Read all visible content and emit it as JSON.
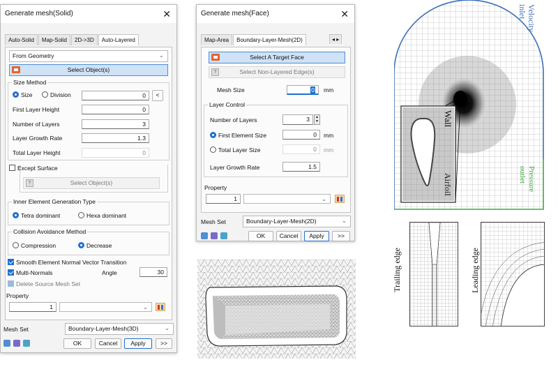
{
  "solid": {
    "title": "Generate mesh(Solid)",
    "tabs": [
      "Auto-Solid",
      "Map-Solid",
      "2D->3D",
      "Auto-Layered"
    ],
    "source": "From Geometry",
    "select_btn": "Select Object(s)",
    "size_method": {
      "label": "Size Method",
      "opt_size": "Size",
      "opt_div": "Division",
      "value": "0",
      "btn": "<"
    },
    "first_layer": {
      "label": "First Layer Height",
      "value": "0"
    },
    "num_layers": {
      "label": "Number of Layers",
      "value": "3"
    },
    "growth": {
      "label": "Layer Growth Rate",
      "value": "1.3"
    },
    "total": {
      "label": "Total Layer Height",
      "value": "0"
    },
    "except": {
      "label": "Except Surface",
      "btn": "Select Object(s)"
    },
    "inner": {
      "label": "Inner Element Generation Type",
      "opt1": "Tetra dominant",
      "opt2": "Hexa dominant"
    },
    "collision": {
      "label": "Collision Avoidance Method",
      "opt1": "Compression",
      "opt2": "Decrease"
    },
    "smooth": "Smooth Element Normal Vector Transition",
    "multi": "Multi-Normals",
    "angle_label": "Angle",
    "angle": "30",
    "delete_src": "Delete Source Mesh Set",
    "property": {
      "label": "Property",
      "id": "1"
    },
    "meshset": {
      "label": "Mesh Set",
      "value": "Boundary-Layer-Mesh(3D)"
    },
    "ok": "OK",
    "cancel": "Cancel",
    "apply": "Apply",
    "more": ">>"
  },
  "face": {
    "title": "Generate mesh(Face)",
    "tabs": [
      "Map-Area",
      "Boundary-Layer-Mesh(2D)"
    ],
    "select_face": "Select A Target Face",
    "select_edge": "Select Non-Layered Edge(s)",
    "mesh_size": {
      "label": "Mesh Size",
      "value": "0",
      "unit": "mm"
    },
    "layer_control": "Layer Control",
    "num_layers": {
      "label": "Number of Layers",
      "value": "3"
    },
    "first_elem": {
      "label": "First Element Size",
      "value": "0",
      "unit": "mm"
    },
    "total_size": {
      "label": "Total Layer Size",
      "value": "0",
      "unit": "mm"
    },
    "growth": {
      "label": "Layer Growth Rate",
      "value": "1.5"
    },
    "property": {
      "label": "Property",
      "id": "1"
    },
    "meshset": {
      "label": "Mesh Set",
      "value": "Boundary-Layer-Mesh(2D)"
    },
    "ok": "OK",
    "cancel": "Cancel",
    "apply": "Apply",
    "more": ">>"
  },
  "figure": {
    "velocity": "Velocity inlet",
    "pressure": "Pressure outlet",
    "wall": "Wall",
    "airfoil": "Airfoil",
    "trailing": "Trailing edge",
    "leading": "Leading edge"
  },
  "colors": {
    "accent": "#1f6fd0",
    "select_btn": "#cfe2f6",
    "inlet": "#3d6fb4",
    "outlet": "#3fa83f"
  }
}
